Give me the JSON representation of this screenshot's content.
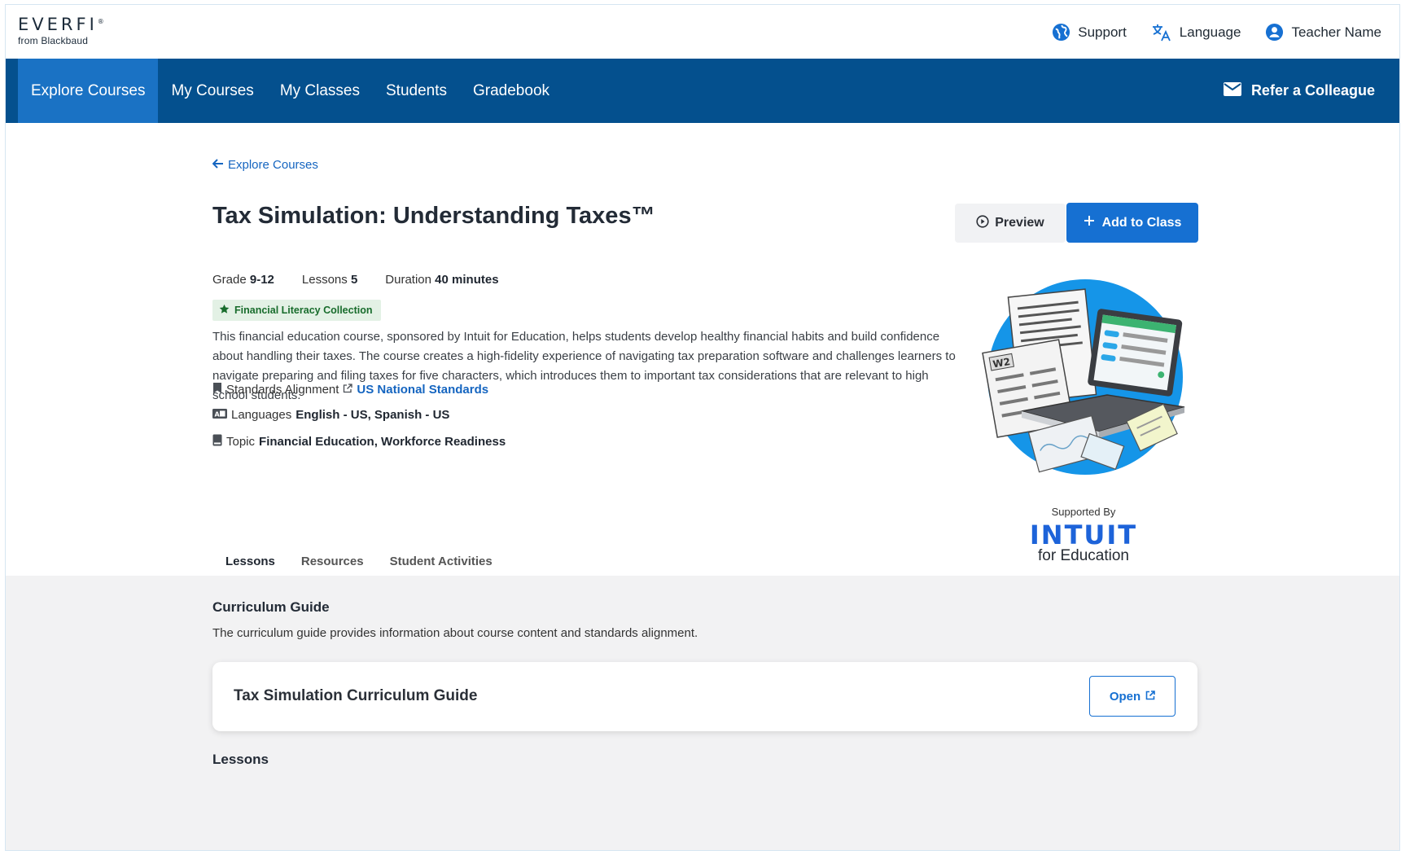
{
  "brand": {
    "name": "EVERFI",
    "registered": "®",
    "tagline": "from Blackbaud"
  },
  "header": {
    "support": "Support",
    "language": "Language",
    "user": "Teacher Name"
  },
  "nav": {
    "items": [
      "Explore Courses",
      "My Courses",
      "My Classes",
      "Students",
      "Gradebook"
    ],
    "active": "Explore Courses",
    "refer": "Refer a Colleague"
  },
  "course": {
    "back_link": "Explore Courses",
    "title": "Tax Simulation: Understanding Taxes™",
    "preview_label": "Preview",
    "add_label": "Add to Class",
    "grade_label": "Grade",
    "grade": "9-12",
    "lessons_label": "Lessons",
    "lessons": "5",
    "duration_label": "Duration",
    "duration": "40 minutes",
    "badge": "Financial Literacy Collection",
    "description": "This financial education course, sponsored by Intuit for Education, helps students develop healthy financial habits and build confidence about handling their taxes. The course creates a high-fidelity experience of navigating tax preparation software and challenges learners to navigate preparing and filing taxes for five characters, which introduces them to important tax considerations that are relevant to high school students.",
    "standards_label": "Standards Alignment",
    "standards_link": "US National Standards",
    "languages_label": "Languages",
    "languages": "English - US, Spanish - US",
    "topic_label": "Topic",
    "topic": "Financial Education, Workforce Readiness",
    "supported_by": "Supported By",
    "sponsor_name": "INTUIT",
    "sponsor_sub": "for Education",
    "illustration_label": "W2"
  },
  "tabs": [
    "Lessons",
    "Resources",
    "Student Activities"
  ],
  "active_tab": "Lessons",
  "curriculum": {
    "title": "Curriculum Guide",
    "description": "The curriculum guide provides information about course content and standards alignment.",
    "card_title": "Tax Simulation Curriculum Guide",
    "open_label": "Open"
  },
  "lessons_heading": "Lessons",
  "colors": {
    "nav_bg": "#04508e",
    "nav_active": "#1a72c4",
    "primary": "#1670d2",
    "badge_bg": "#e3f1e5",
    "badge_text": "#186c2c"
  }
}
